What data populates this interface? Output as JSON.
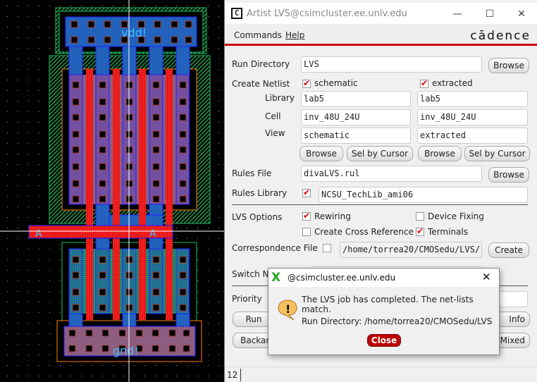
{
  "background_window": {
    "tab_text": "extracted"
  },
  "layout_view": {
    "labels": {
      "vdd": "vdd!",
      "gnd": "gnd!",
      "input_left": "A",
      "input_right": "A"
    }
  },
  "lvs_window": {
    "title": "Artist LVS@csimcluster.ee.unlv.edu",
    "menu": [
      "Commands",
      "Help"
    ],
    "logo": "cādence",
    "run_directory": {
      "label": "Run Directory",
      "value": "LVS",
      "browse": "Browse"
    },
    "create_netlist": {
      "label": "Create Netlist",
      "schematic": {
        "checkbox": "schematic",
        "checked": true,
        "library": "lab5",
        "cell": "inv_48U_24U",
        "view": "schematic"
      },
      "extracted": {
        "checkbox": "extracted",
        "checked": true,
        "library": "lab5",
        "cell": "inv_48U_24U",
        "view": "extracted"
      },
      "library_label": "Library",
      "cell_label": "Cell",
      "view_label": "View",
      "browse": "Browse",
      "sel_by_cursor": "Sel by Cursor"
    },
    "rules_file": {
      "label": "Rules File",
      "value": "divaLVS.rul",
      "browse": "Browse"
    },
    "rules_library": {
      "label": "Rules Library",
      "checked": true,
      "value": "NCSU_TechLib_ami06"
    },
    "lvs_options": {
      "label": "LVS Options",
      "rewiring": {
        "label": "Rewiring",
        "checked": true
      },
      "device_fixing": {
        "label": "Device Fixing",
        "checked": false
      },
      "create_cross_reference": {
        "label": "Create Cross Reference",
        "checked": false
      },
      "terminals": {
        "label": "Terminals",
        "checked": true
      }
    },
    "correspondence_file": {
      "label": "Correspondence File",
      "checked": false,
      "value": "/home/torrea20/CMOSedu/LVS/",
      "create": "Create"
    },
    "switch_names": {
      "label": "Switch N"
    },
    "priority": {
      "label": "Priority"
    },
    "buttons": {
      "run": "Run",
      "info": "Info",
      "backannotate": "Backan",
      "mixed": "Mixed"
    },
    "status": "12"
  },
  "popup": {
    "title": "@csimcluster.ee.unlv.edu",
    "message": "The LVS job has completed. The net-lists match.",
    "run_directory": "Run Directory: /home/torrea20/CMOSedu/LVS",
    "close": "Close",
    "icon": "warning-speech-bubble-icon"
  },
  "colors": {
    "accent": "#cc0000",
    "metal1": "#2020ff",
    "poly": "#ff2020",
    "nwell": "#20c060",
    "select": "#ff8000"
  }
}
